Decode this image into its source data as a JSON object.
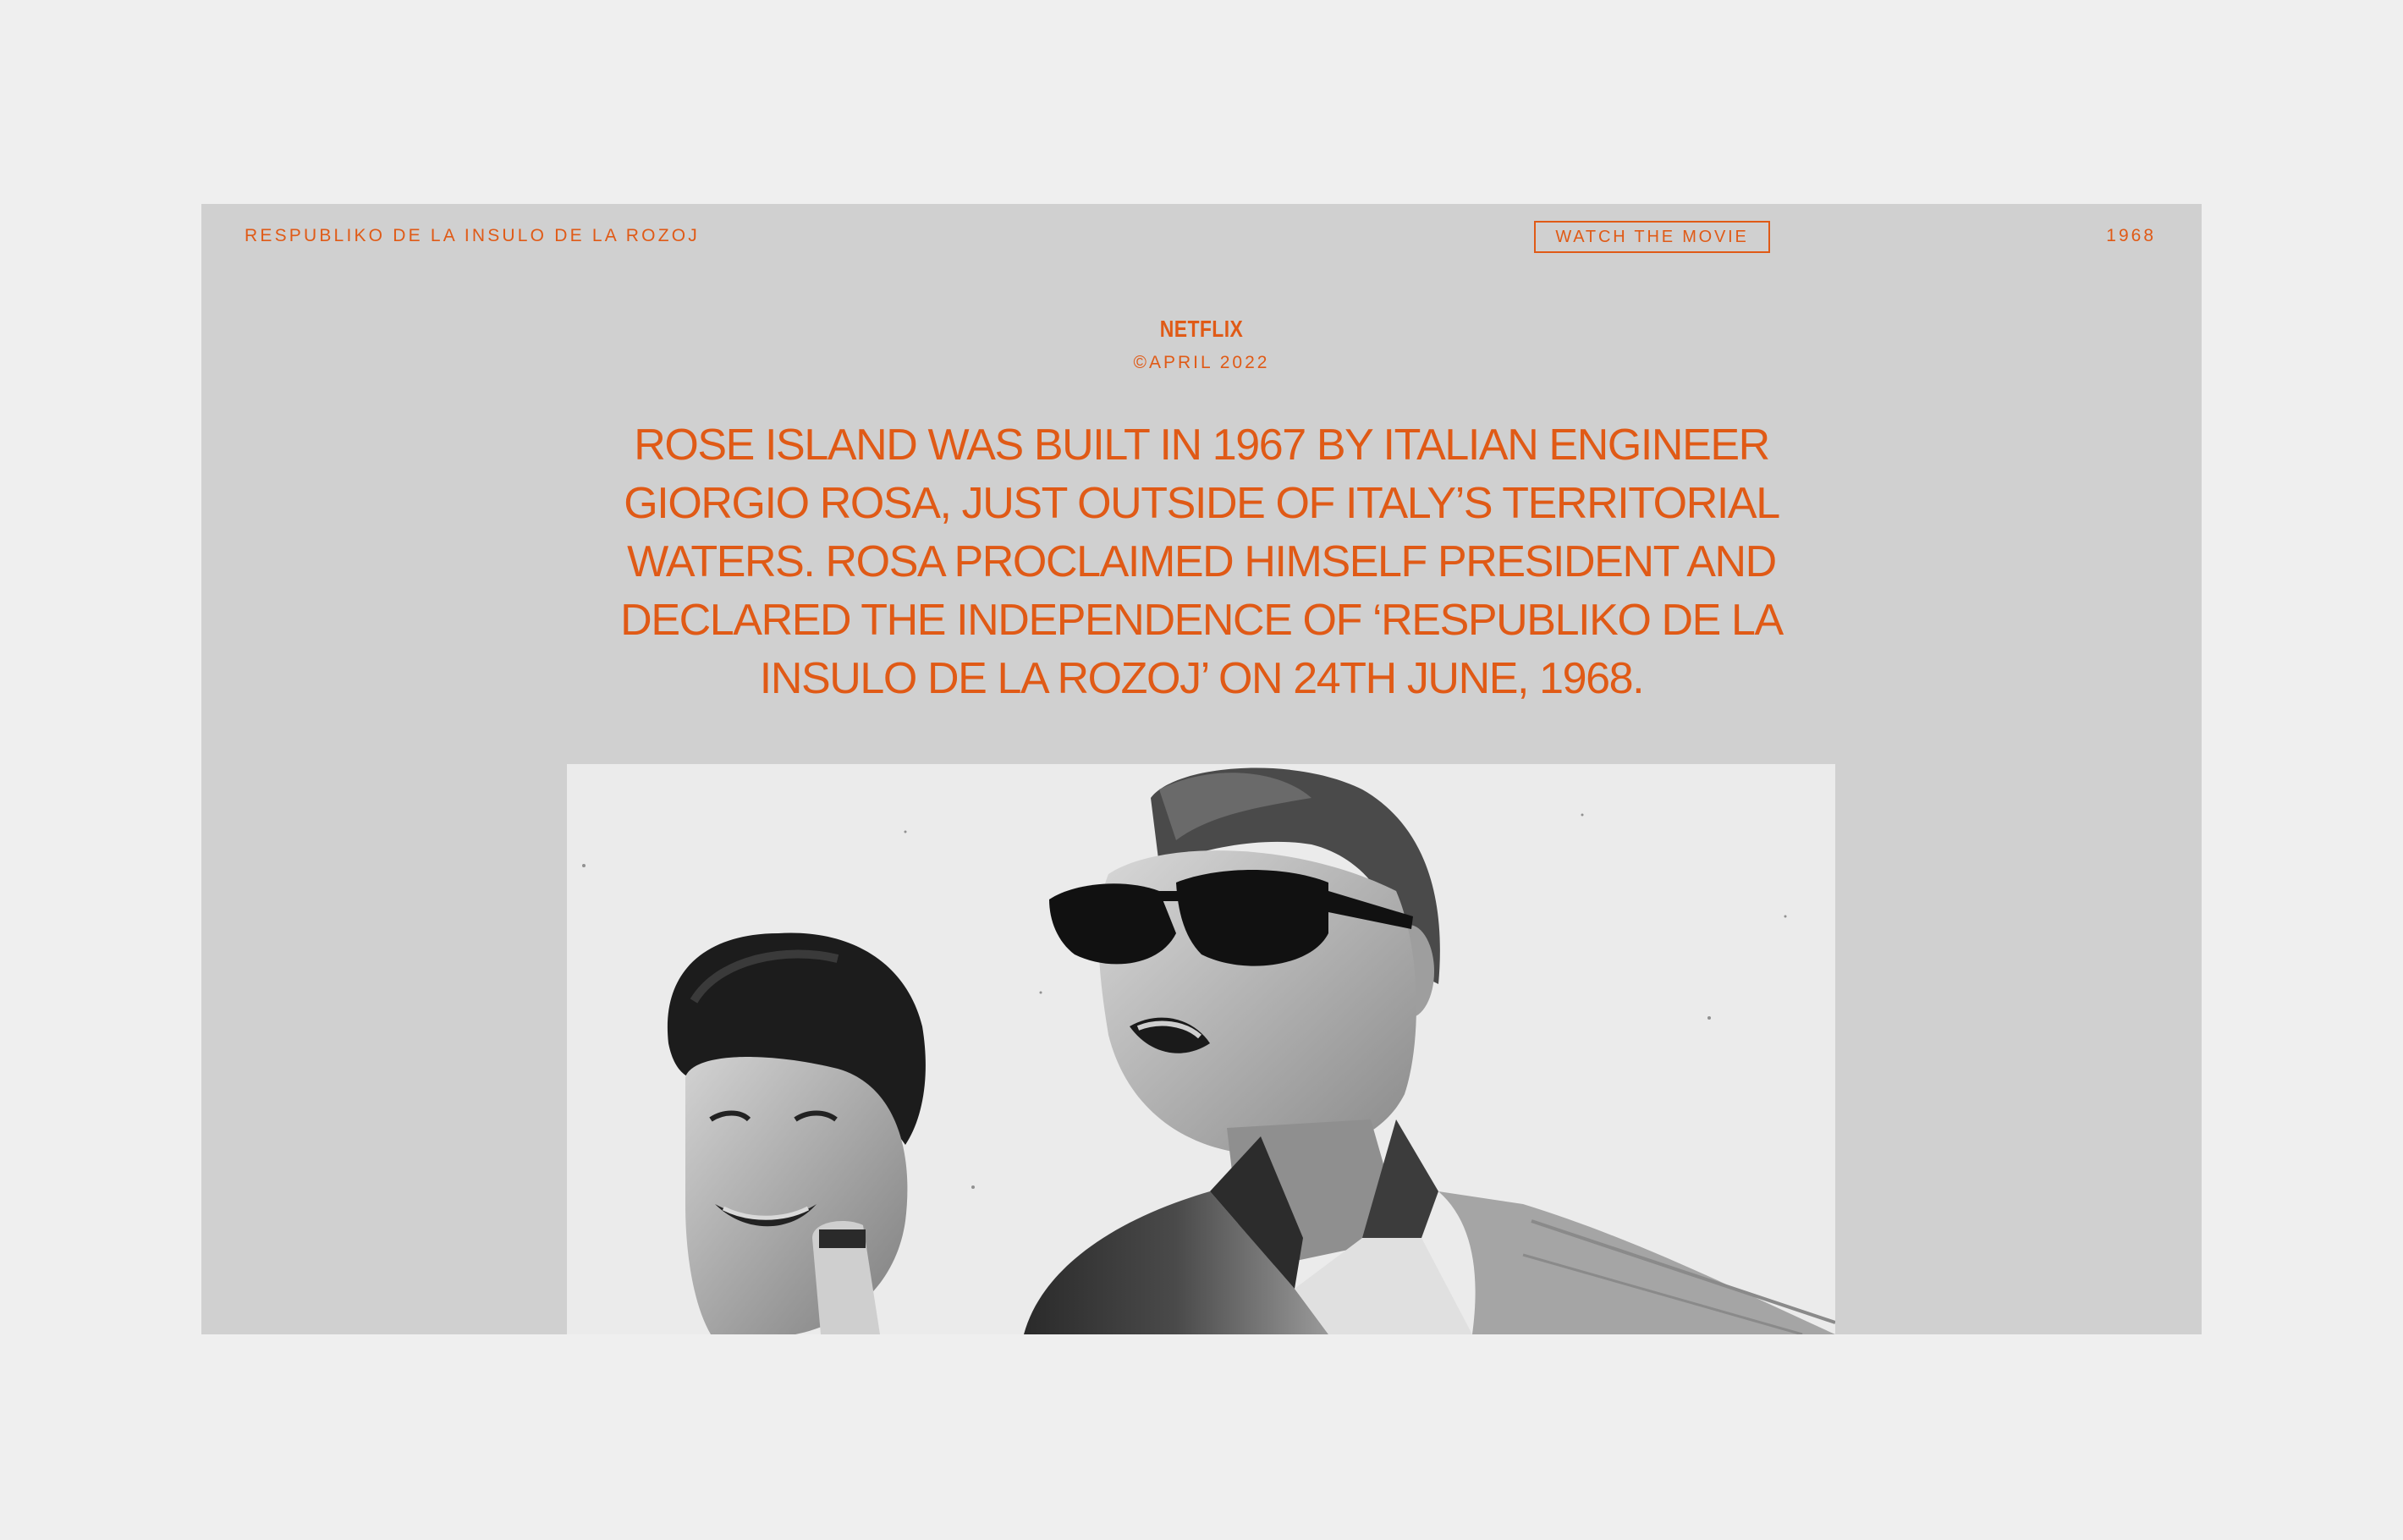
{
  "header": {
    "site_title": "RESPUBLIKO DE LA INSULO DE LA ROZOJ",
    "cta_label": "WATCH THE MOVIE",
    "year": "1968"
  },
  "hero": {
    "brand": "NETFLIX",
    "date": "©APRIL 2022",
    "headline": "ROSE ISLAND WAS BUILT IN 1967 BY ITALIAN ENGINEER GIORGIO ROSA, JUST OUTSIDE OF ITALY’S TERRITORIAL WATERS. ROSA PROCLAIMED HIMSELF PRESIDENT AND DECLARED THE INDEPENDENCE OF ‘RESPUBLIKO DE LA INSULO DE LA ROZOJ’ ON 24TH JUNE, 1968."
  },
  "photo": {
    "style": "black-and-white",
    "subject": "smiling woman and man wearing sunglasses"
  },
  "colors": {
    "page_background": "#efefef",
    "panel_background": "#d0d0d0",
    "accent": "#e05a16"
  }
}
